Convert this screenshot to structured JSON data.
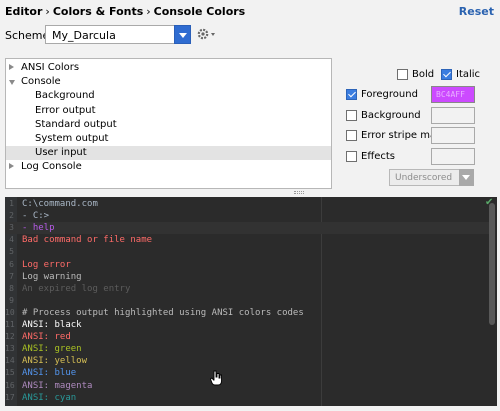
{
  "breadcrumb": [
    "Editor",
    "Colors & Fonts",
    "Console Colors"
  ],
  "reset_label": "Reset",
  "scheme": {
    "label": "Scheme:",
    "value": "My_Darcula"
  },
  "tree": [
    {
      "label": "ANSI Colors",
      "expander": "collapsed",
      "selected": false
    },
    {
      "label": "Console",
      "expander": "expanded",
      "selected": false
    },
    {
      "label": "Background",
      "expander": "none",
      "selected": false
    },
    {
      "label": "Error output",
      "expander": "none",
      "selected": false
    },
    {
      "label": "Standard output",
      "expander": "none",
      "selected": false
    },
    {
      "label": "System output",
      "expander": "none",
      "selected": false
    },
    {
      "label": "User input",
      "expander": "none",
      "selected": true
    },
    {
      "label": "Log Console",
      "expander": "collapsed",
      "selected": false
    }
  ],
  "options": {
    "bold": {
      "label": "Bold",
      "checked": false
    },
    "italic": {
      "label": "Italic",
      "checked": true
    },
    "foreground": {
      "label": "Foreground",
      "checked": true,
      "color": "#CC4AFF",
      "hex": "BC4AFF"
    },
    "background": {
      "label": "Background",
      "checked": false
    },
    "error_stripe": {
      "label": "Error stripe mark",
      "checked": false
    },
    "effects": {
      "label": "Effects",
      "checked": false,
      "style": "Underscored"
    }
  },
  "editor_lines": [
    {
      "n": "1",
      "text": "C:\\command.com",
      "color": "#a9b7c6"
    },
    {
      "n": "2",
      "text": "- C:>",
      "color": "#a9b7c6"
    },
    {
      "n": "3",
      "text": "- help",
      "color": "#b65be8"
    },
    {
      "n": "4",
      "text": "Bad command or file name",
      "color": "#ff6b68"
    },
    {
      "n": "5",
      "text": "",
      "color": "#a9b7c6"
    },
    {
      "n": "6",
      "text": "Log error",
      "color": "#ff6b68"
    },
    {
      "n": "7",
      "text": "Log warning",
      "color": "#bbbbbb"
    },
    {
      "n": "8",
      "text": "An expired log entry",
      "color": "#5c5c5c"
    },
    {
      "n": "9",
      "text": "",
      "color": "#a9b7c6"
    },
    {
      "n": "10",
      "text": "# Process output highlighted using ANSI colors codes",
      "color": "#bbbbbb"
    },
    {
      "n": "11",
      "text": "ANSI: black",
      "color": "#ffffff"
    },
    {
      "n": "12",
      "text": "ANSI: red",
      "color": "#ff6b68"
    },
    {
      "n": "13",
      "text": "ANSI: green",
      "color": "#a8c023"
    },
    {
      "n": "14",
      "text": "ANSI: yellow",
      "color": "#d6bf55"
    },
    {
      "n": "15",
      "text": "ANSI: blue",
      "color": "#5394ec"
    },
    {
      "n": "16",
      "text": "ANSI: magenta",
      "color": "#ae8abe"
    },
    {
      "n": "17",
      "text": "ANSI: cyan",
      "color": "#299999"
    }
  ],
  "current_line": 3,
  "colors": {
    "accent": "#2F6CD1",
    "editor_bg": "#2B2B2B",
    "selection": "#E3E3E3"
  }
}
